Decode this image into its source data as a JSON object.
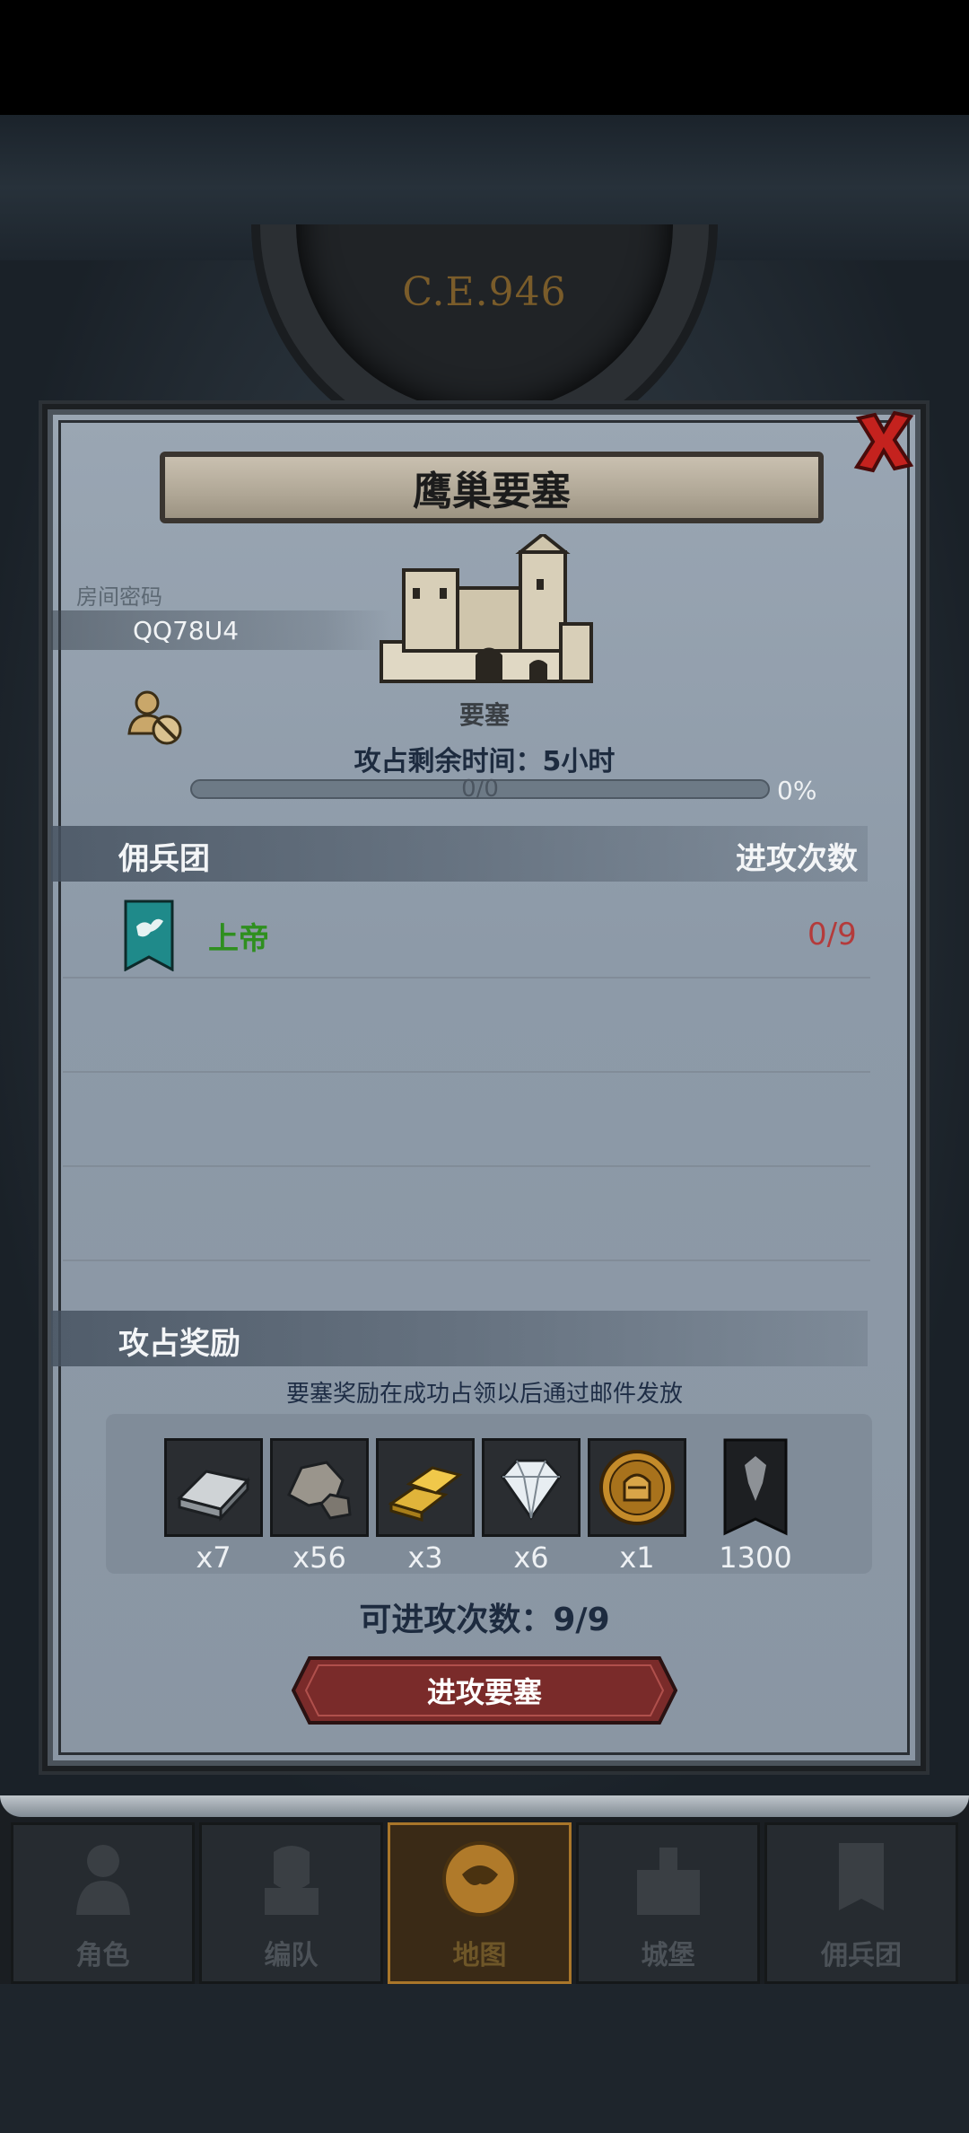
{
  "background": {
    "era_text": "C.E.946"
  },
  "modal": {
    "title": "鹰巢要塞",
    "room_label": "房间密码",
    "room_code": "QQ78U4",
    "fortress_type": "要塞",
    "time_label": "攻占剩余时间：5小时",
    "progress": {
      "text": "0/0",
      "percent_text": "0%",
      "fill_fraction": 0
    },
    "mercenary_section": {
      "title": "佣兵团",
      "attack_header": "进攻次数"
    },
    "guilds": [
      {
        "name": "上帝",
        "attacks": "0/9"
      }
    ],
    "rewards_section": {
      "title": "攻占奖励",
      "note": "要塞奖励在成功占领以后通过邮件发放",
      "items": [
        {
          "icon": "iron-ingot-icon",
          "qty": "x7"
        },
        {
          "icon": "stone-icon",
          "qty": "x56"
        },
        {
          "icon": "gold-bars-icon",
          "qty": "x3"
        },
        {
          "icon": "diamond-icon",
          "qty": "x6"
        },
        {
          "icon": "knight-coin-icon",
          "qty": "x1"
        }
      ],
      "banner_reward": {
        "icon": "guild-banner-icon",
        "qty": "1300"
      }
    },
    "attempts_text": "可进攻次数：9/9",
    "attack_button": "进攻要塞"
  },
  "nav": {
    "tabs": [
      {
        "label": "角色",
        "icon": "character-icon",
        "active": false
      },
      {
        "label": "编队",
        "icon": "formation-icon",
        "active": false
      },
      {
        "label": "地图",
        "icon": "map-icon",
        "active": true
      },
      {
        "label": "城堡",
        "icon": "castle-icon",
        "active": false
      },
      {
        "label": "佣兵团",
        "icon": "mercenary-icon",
        "active": false
      }
    ]
  },
  "colors": {
    "accent_gold": "#c59a3c",
    "guild_name_green": "#2f8f1f",
    "attack_count_red": "#b43b3b",
    "button_red": "#7a2b2a"
  }
}
